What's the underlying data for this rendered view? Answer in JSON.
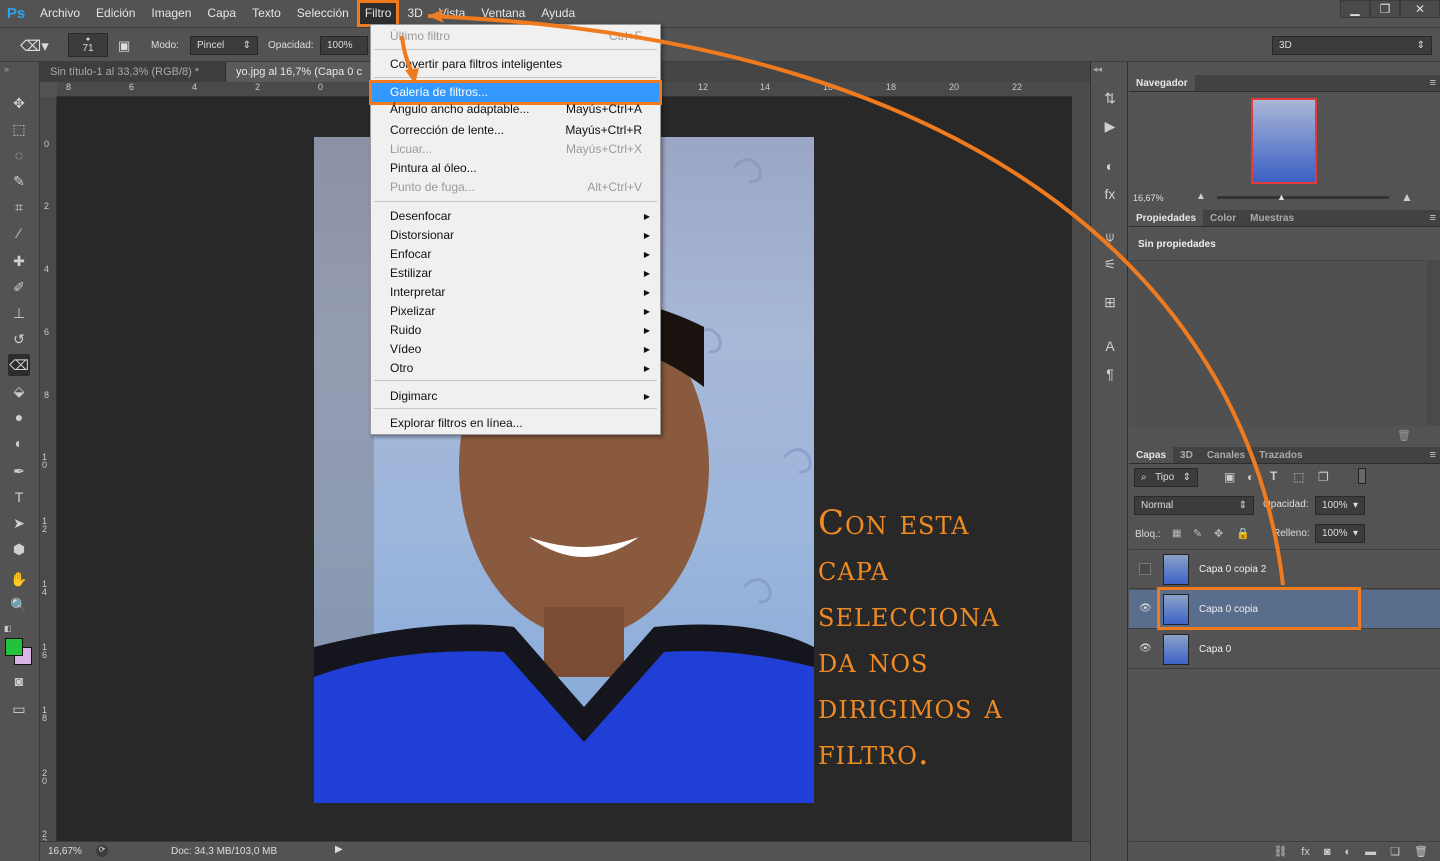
{
  "app": {
    "logo": "Ps"
  },
  "menubar": {
    "items": [
      "Archivo",
      "Edición",
      "Imagen",
      "Capa",
      "Texto",
      "Selección",
      "Filtro",
      "3D",
      "Vista",
      "Ventana",
      "Ayuda"
    ],
    "active": "Filtro"
  },
  "window_buttons": [
    "minimize-icon",
    "restore-icon",
    "close-icon"
  ],
  "options_bar": {
    "brush_size": "71",
    "mode_label": "Modo:",
    "mode_value": "Pincel",
    "opacity_label": "Opacidad:",
    "opacity_value": "100%",
    "workspace_value": "3D"
  },
  "doc_tabs": [
    "Sin título-1 al 33,3% (RGB/8) *",
    "yo.jpg al 16,7% (Capa 0 c"
  ],
  "ruler_h": [
    "8",
    "6",
    "4",
    "2",
    "0",
    "12",
    "14",
    "16",
    "18",
    "20",
    "22"
  ],
  "ruler_v": [
    "0",
    "2",
    "4",
    "6",
    "8",
    "1 0",
    "1 2",
    "1 4",
    "1 6",
    "1 8",
    "2 0",
    "2 2"
  ],
  "status": {
    "zoom": "16,67%",
    "doc": "Doc: 34,3 MB/103,0 MB"
  },
  "filter_menu": {
    "items": [
      {
        "label": "Último filtro",
        "shortcut": "Ctrl+F",
        "disabled": true
      },
      {
        "label": "Convertir para filtros inteligentes",
        "shortcut": "",
        "disabled": false
      },
      {
        "label": "Galería de filtros...",
        "shortcut": "",
        "disabled": false,
        "highlight": true
      },
      {
        "label": "Ángulo ancho adaptable...",
        "shortcut": "Mayús+Ctrl+A",
        "disabled": false
      },
      {
        "label": "Corrección de lente...",
        "shortcut": "Mayús+Ctrl+R",
        "disabled": false
      },
      {
        "label": "Licuar...",
        "shortcut": "Mayús+Ctrl+X",
        "disabled": true
      },
      {
        "label": "Pintura al óleo...",
        "shortcut": "",
        "disabled": false
      },
      {
        "label": "Punto de fuga...",
        "shortcut": "Alt+Ctrl+V",
        "disabled": true
      },
      {
        "label": "Desenfocar",
        "submenu": true
      },
      {
        "label": "Distorsionar",
        "submenu": true
      },
      {
        "label": "Enfocar",
        "submenu": true
      },
      {
        "label": "Estilizar",
        "submenu": true
      },
      {
        "label": "Interpretar",
        "submenu": true
      },
      {
        "label": "Pixelizar",
        "submenu": true
      },
      {
        "label": "Ruido",
        "submenu": true
      },
      {
        "label": "Vídeo",
        "submenu": true
      },
      {
        "label": "Otro",
        "submenu": true
      },
      {
        "label": "Digimarc",
        "submenu": true
      },
      {
        "label": "Explorar filtros en línea..."
      }
    ]
  },
  "navigator": {
    "title": "Navegador",
    "zoom": "16,67%"
  },
  "properties": {
    "tabs": [
      "Propiedades",
      "Color",
      "Muestras"
    ],
    "content": "Sin propiedades"
  },
  "layers_panel": {
    "tabs": [
      "Capas",
      "3D",
      "Canales",
      "Trazados"
    ],
    "filter_kind": "Tipo",
    "blend_mode": "Normal",
    "opacity_label": "Opacidad:",
    "opacity_value": "100%",
    "lock_label": "Bloq.:",
    "fill_label": "Relleno:",
    "fill_value": "100%",
    "layers": [
      {
        "name": "Capa 0 copia 2",
        "visible": false,
        "selected": false
      },
      {
        "name": "Capa 0 copia",
        "visible": true,
        "selected": true
      },
      {
        "name": "Capa 0",
        "visible": true,
        "selected": false
      }
    ]
  },
  "annotation": {
    "lines": [
      "Con esta",
      "capa",
      "selecciona",
      "da nos",
      "dirigimos a",
      "filtro."
    ],
    "color": "#f08a22"
  },
  "colors": {
    "foreground": "#22c23a",
    "background": "#d9b4e6",
    "highlight": "#3399ff",
    "accent": "#f07b1f"
  }
}
